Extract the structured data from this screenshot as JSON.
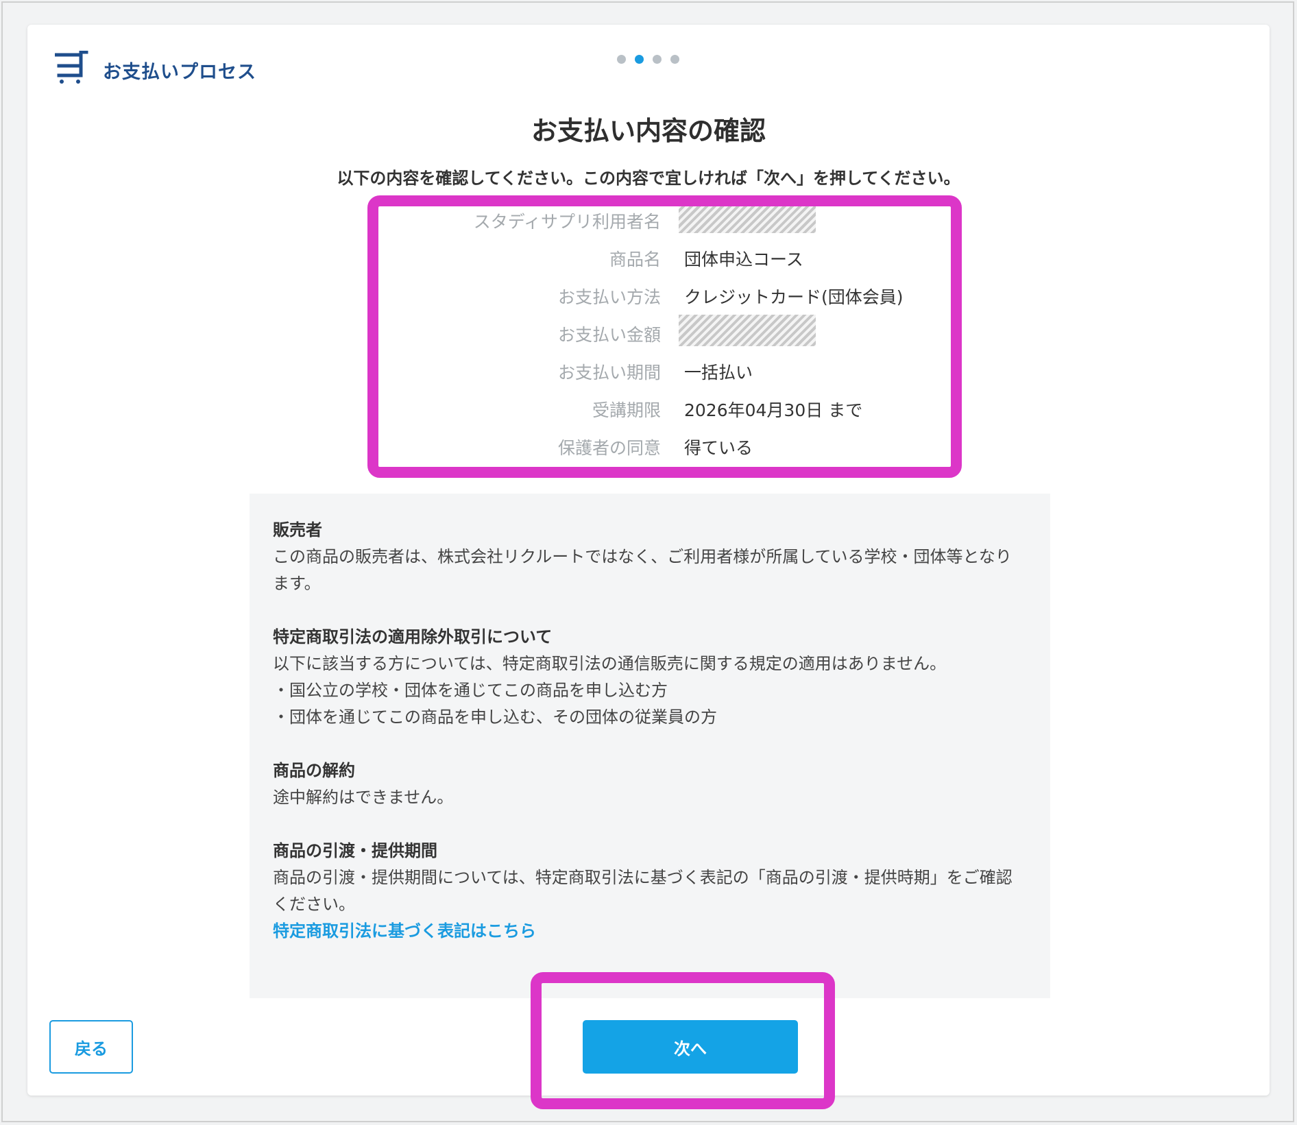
{
  "header": {
    "app_title": "お支払いプロセス",
    "icon": "cart-icon",
    "steps": {
      "total": 4,
      "current": 2
    }
  },
  "page": {
    "title": "お支払い内容の確認",
    "subtitle": "以下の内容を確認してください。この内容で宜しければ「次へ」を押してください。"
  },
  "summary": {
    "rows": [
      {
        "label": "スタディサプリ利用者名",
        "value": "",
        "redacted": true
      },
      {
        "label": "商品名",
        "value": "団体申込コース"
      },
      {
        "label": "お支払い方法",
        "value": "クレジットカード(団体会員)"
      },
      {
        "label": "お支払い金額",
        "value": "",
        "redacted": true
      },
      {
        "label": "お支払い期間",
        "value": "一括払い"
      },
      {
        "label": "受講期限",
        "value": "2026年04月30日 まで"
      },
      {
        "label": "保護者の同意",
        "value": "得ている"
      }
    ]
  },
  "info": {
    "seller_head": "販売者",
    "seller_body": "この商品の販売者は、株式会社リクルートではなく、ご利用者様が所属している学校・団体等となります。",
    "exempt_head": "特定商取引法の適用除外取引について",
    "exempt_body": "以下に該当する方については、特定商取引法の通信販売に関する規定の適用はありません。",
    "exempt_item1": "・国公立の学校・団体を通じてこの商品を申し込む方",
    "exempt_item2": "・団体を通じてこの商品を申し込む、その団体の従業員の方",
    "cancel_head": "商品の解約",
    "cancel_body": "途中解約はできません。",
    "delivery_head": "商品の引渡・提供期間",
    "delivery_body": "商品の引渡・提供期間については、特定商取引法に基づく表記の「商品の引渡・提供時期」をご確認ください。",
    "link_text": "特定商取引法に基づく表記はこちら"
  },
  "buttons": {
    "back": "戻る",
    "next": "次へ"
  },
  "colors": {
    "accent": "#14a3e6",
    "brand": "#1f4e8c",
    "highlight": "#dc36c8"
  }
}
